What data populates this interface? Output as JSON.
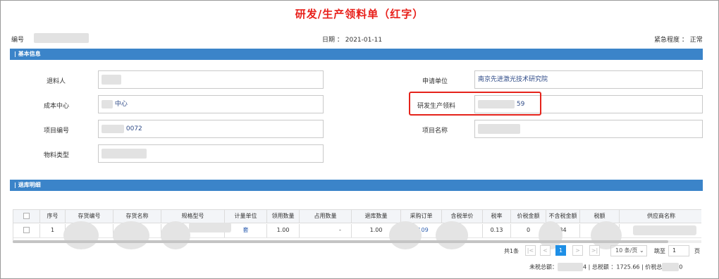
{
  "title": "研发/生产领料单（红字）",
  "header": {
    "code_label": "编号",
    "date_label": "日期 ：",
    "date_value": "2021-01-11",
    "urgency_label": "紧急程度 ：",
    "urgency_value": "正常"
  },
  "basic_info": {
    "section_title": "| 基本信息",
    "fields": {
      "returner_label": "退料人",
      "returner_value": "",
      "cost_center_label": "成本中心",
      "cost_center_value": "中心",
      "project_code_label": "项目编号",
      "project_code_value": "0072",
      "material_type_label": "物料类型",
      "material_type_value": "",
      "applying_unit_label": "申请单位",
      "applying_unit_value": "南京先进激光技术研究院",
      "rd_picking_label": "研发生产领料",
      "rd_picking_value": "59",
      "project_name_label": "项目名称",
      "project_name_value": ""
    }
  },
  "return_details": {
    "section_title": "| 退库明细",
    "columns": [
      "序号",
      "存货编号",
      "存货名称",
      "规格型号",
      "计量单位",
      "领用数量",
      "占用数量",
      "退库数量",
      "采购订单",
      "含税单价",
      "税率",
      "价税金额",
      "不含税金额",
      "税额",
      "供应商名称"
    ],
    "rows": [
      {
        "index": "1",
        "item_code": "",
        "item_name": "",
        "spec": "",
        "unit": "套",
        "picked_qty": "1.00",
        "occupied_qty": "",
        "return_qty": "1.00",
        "return_prefix": "-",
        "purchase_order": "0109",
        "unit_price": "00",
        "tax_rate": "0.13",
        "tax_amount_total": "0",
        "amount_excl_tax": "34",
        "tax": "",
        "supplier": ""
      }
    ]
  },
  "pagination": {
    "total_text": "共1条",
    "first": "|<",
    "prev": "<",
    "current_page": "1",
    "next": ">",
    "last": ">|",
    "page_size": "10 条/页",
    "page_size_caret": "⌄",
    "jump_label": "跳至",
    "jump_value": "1",
    "page_suffix": "页"
  },
  "summary": {
    "excl_tax_label": "未税总额：",
    "excl_tax_tail": "4",
    "sep1": " | ",
    "total_label": "总税额 ：",
    "total_value": "1725.66",
    "sep2": " | ",
    "incl_tax_label": "价税总",
    "incl_tax_tail": "0"
  },
  "colors": {
    "title_red": "#e8201b",
    "section_blue": "#3b84c9",
    "highlight_red": "#e5231b",
    "link_blue": "#2e4a87",
    "pager_active": "#1e8fe6"
  }
}
